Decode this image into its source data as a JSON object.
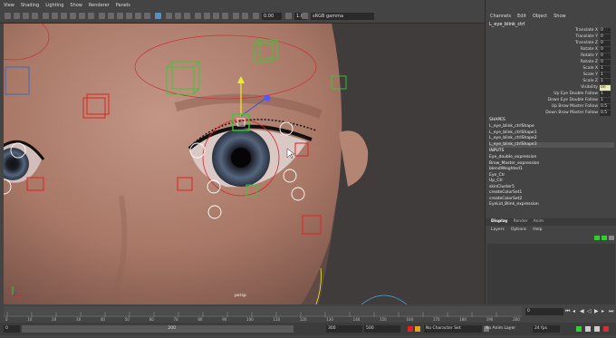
{
  "menus": [
    "View",
    "Shading",
    "Lighting",
    "Show",
    "Renderer",
    "Panels"
  ],
  "toolbar": {
    "exposure": "0.00",
    "gamma": "1.00",
    "colorspace": "sRGB gamma"
  },
  "viewport": {
    "camera_label": "persp"
  },
  "channelbox": {
    "menus": [
      "Channels",
      "Edit",
      "Object",
      "Show"
    ],
    "object_name": "L_eye_blink_ctrl",
    "attributes": [
      {
        "name": "Translate X",
        "value": "0"
      },
      {
        "name": "Translate Y",
        "value": "0"
      },
      {
        "name": "Translate Z",
        "value": "0"
      },
      {
        "name": "Rotate X",
        "value": "0"
      },
      {
        "name": "Rotate Y",
        "value": "0"
      },
      {
        "name": "Rotate Z",
        "value": "0"
      },
      {
        "name": "Scale X",
        "value": "1"
      },
      {
        "name": "Scale Y",
        "value": "1"
      },
      {
        "name": "Scale Z",
        "value": "1"
      },
      {
        "name": "Visibility",
        "value": "on"
      },
      {
        "name": "Up Eye Double Follow",
        "value": "1"
      },
      {
        "name": "Down Eye Double Follow",
        "value": "1"
      },
      {
        "name": "Up Brow Master Follow",
        "value": "0.5"
      },
      {
        "name": "Down Brow Master Follow",
        "value": "0.5"
      }
    ],
    "shapes_header": "SHAPES",
    "shapes": [
      "L_eye_blink_ctrlShape",
      "L_eye_blink_ctrlShape1",
      "L_eye_blink_ctrlShape2",
      "L_eye_blink_ctrlShape3"
    ],
    "inputs_header": "INPUTS",
    "inputs": [
      "Eye_double_expression",
      "Brow_Master_expression",
      "blendWeighted1",
      "Eye_Ctr",
      "Up_Ctr",
      "skinCluster5",
      "createColorSet1",
      "createColorSet2",
      "EyeLid_Blink_expression"
    ]
  },
  "layer_tabs": [
    "Display",
    "Render",
    "Anim"
  ],
  "layer_menu": [
    "Layers",
    "Options",
    "Help"
  ],
  "timeline": {
    "ticks": [
      "0",
      "10",
      "20",
      "30",
      "40",
      "50",
      "60",
      "70",
      "80",
      "90",
      "100",
      "110",
      "120",
      "130",
      "140",
      "150",
      "160",
      "170",
      "180",
      "190",
      "200"
    ],
    "current_frame": "0",
    "range_start": "0",
    "range_end": "200",
    "anim_end": "300",
    "anim_end2": "500",
    "character_set": "No Character Set",
    "anim_layer": "No Anim Layer",
    "fps": "24 fps"
  },
  "colors": {
    "control_red": "#d22",
    "control_green": "#3c3",
    "highlight_yellow": "#ee2",
    "ui_bg": "#444"
  }
}
